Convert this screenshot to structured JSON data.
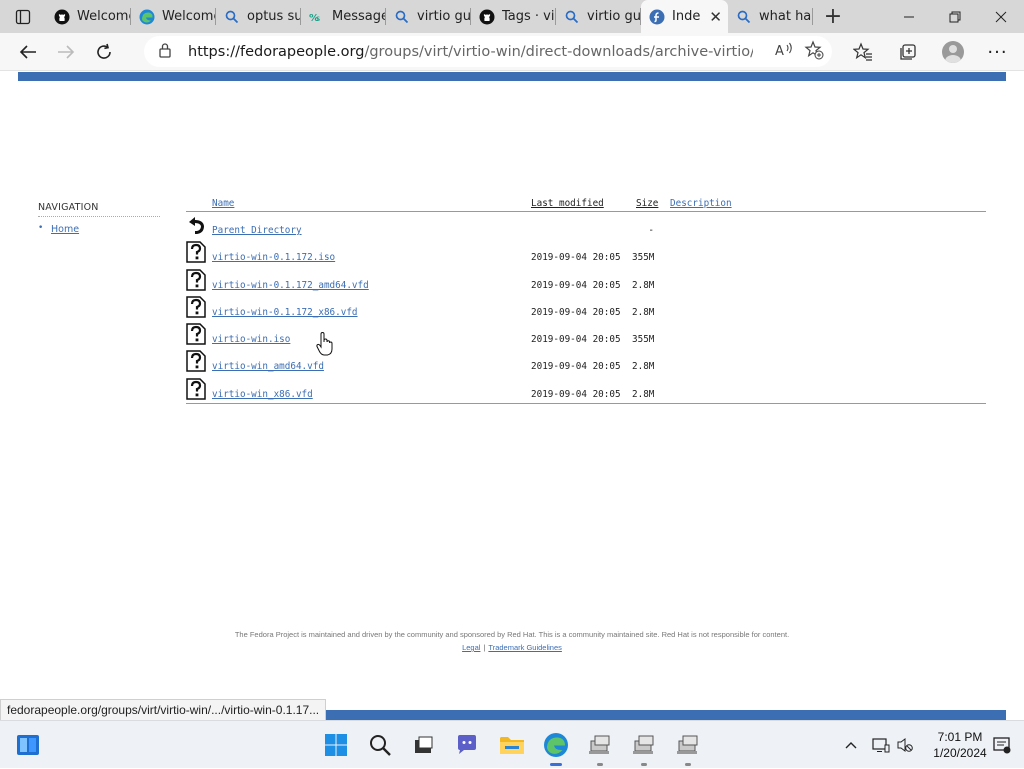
{
  "browser": {
    "tabs": [
      {
        "title": "Welcome",
        "icon": "github-icon",
        "active": false
      },
      {
        "title": "Welcome",
        "icon": "edge-icon",
        "active": false
      },
      {
        "title": "optus su",
        "icon": "search-icon",
        "active": false
      },
      {
        "title": "Message",
        "icon": "message-icon",
        "active": false
      },
      {
        "title": "virtio gu",
        "icon": "search-icon",
        "active": false
      },
      {
        "title": "Tags · vir",
        "icon": "github-icon",
        "active": false
      },
      {
        "title": "virtio gu",
        "icon": "search-icon",
        "active": false
      },
      {
        "title": "Inde",
        "icon": "fedora-icon",
        "active": true
      },
      {
        "title": "what hap",
        "icon": "search-icon",
        "active": false
      }
    ],
    "url_host": "https://fedorapeople.org",
    "url_rest": "/groups/virt/virtio-win/direct-downloads/archive-virtio/virtio-wi..."
  },
  "nav": {
    "title": "NAVIGATION",
    "items": [
      {
        "label": "Home"
      }
    ]
  },
  "listing": {
    "headers": {
      "name": "Name",
      "modified": "Last modified",
      "size": "Size",
      "description": "Description"
    },
    "rows": [
      {
        "name": "Parent Directory",
        "modified": "",
        "size": "-",
        "icon": "back-icon"
      },
      {
        "name": "virtio-win-0.1.172.iso",
        "modified": "2019-09-04 20:05",
        "size": "355M",
        "icon": "unknown-file-icon"
      },
      {
        "name": "virtio-win-0.1.172_amd64.vfd",
        "modified": "2019-09-04 20:05",
        "size": "2.8M",
        "icon": "unknown-file-icon"
      },
      {
        "name": "virtio-win-0.1.172_x86.vfd",
        "modified": "2019-09-04 20:05",
        "size": "2.8M",
        "icon": "unknown-file-icon"
      },
      {
        "name": "virtio-win.iso",
        "modified": "2019-09-04 20:05",
        "size": "355M",
        "icon": "unknown-file-icon"
      },
      {
        "name": "virtio-win_amd64.vfd",
        "modified": "2019-09-04 20:05",
        "size": "2.8M",
        "icon": "unknown-file-icon"
      },
      {
        "name": "virtio-win_x86.vfd",
        "modified": "2019-09-04 20:05",
        "size": "2.8M",
        "icon": "unknown-file-icon"
      }
    ]
  },
  "footer": {
    "text": "The Fedora Project is maintained and driven by the community and sponsored by Red Hat. This is a community maintained site. Red Hat is not responsible for content.",
    "legal": "Legal",
    "separator": "|",
    "trademark": "Trademark Guidelines"
  },
  "status_tip": "fedorapeople.org/groups/virt/virtio-win/.../virtio-win-0.1.17...",
  "taskbar": {
    "time": "7:01 PM",
    "date": "1/20/2024"
  },
  "colors": {
    "fedora_blue": "#3c6eb4",
    "tab_strip": "#d7d7d7",
    "toolbar": "#f7f7f7"
  }
}
